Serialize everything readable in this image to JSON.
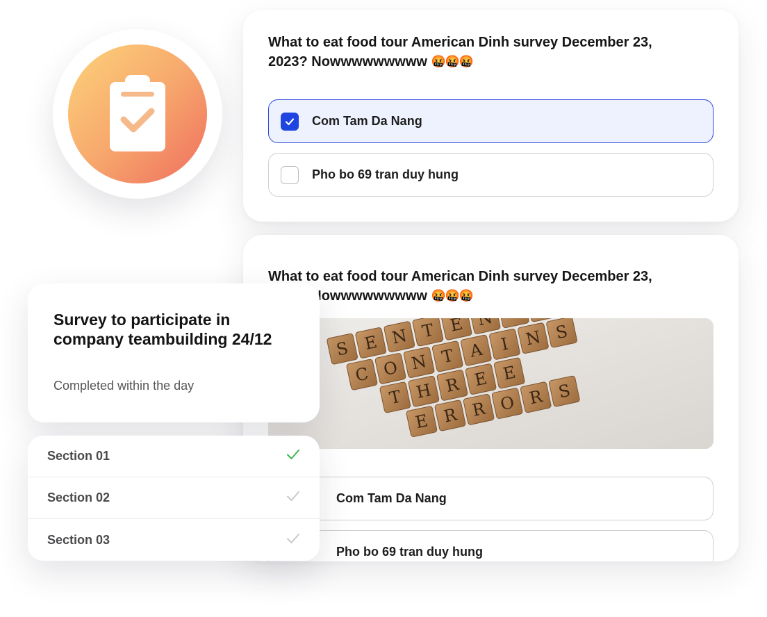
{
  "question_card_1": {
    "question": "What to eat food tour American Dinh survey December 23, 2023? Nowwwwwwwww",
    "emojis": "🤬🤬🤬",
    "options": [
      {
        "label": "Com Tam Da Nang",
        "checked": true
      },
      {
        "label": "Pho bo 69 tran duy hung",
        "checked": false
      }
    ]
  },
  "question_card_2": {
    "question": "What to eat food tour American Dinh survey December 23, 2023? Nowwwwwwwww",
    "emojis": "🤬🤬🤬",
    "image_tiles": [
      "SENTENCE",
      "CONTAINS",
      "THREE",
      "ERRORS"
    ],
    "options": [
      {
        "label": "Com Tam Da Nang",
        "checked": false
      },
      {
        "label": "Pho bo 69 tran duy hung",
        "checked": false
      }
    ]
  },
  "survey": {
    "title": "Survey to participate in company teambuilding 24/12",
    "subtitle": "Completed within the day"
  },
  "sections": [
    {
      "label": "Section 01",
      "status": "completed",
      "check_color": "#3ab54a"
    },
    {
      "label": "Section 02",
      "status": "pending",
      "check_color": "#c9c9cc"
    },
    {
      "label": "Section 03",
      "status": "pending",
      "check_color": "#c9c9cc"
    }
  ],
  "colors": {
    "accent": "#1f45e0",
    "selected_bg": "#eef2fe",
    "icon_gradient": [
      "#fdd27a",
      "#f7a96d",
      "#ef6e5e"
    ]
  }
}
